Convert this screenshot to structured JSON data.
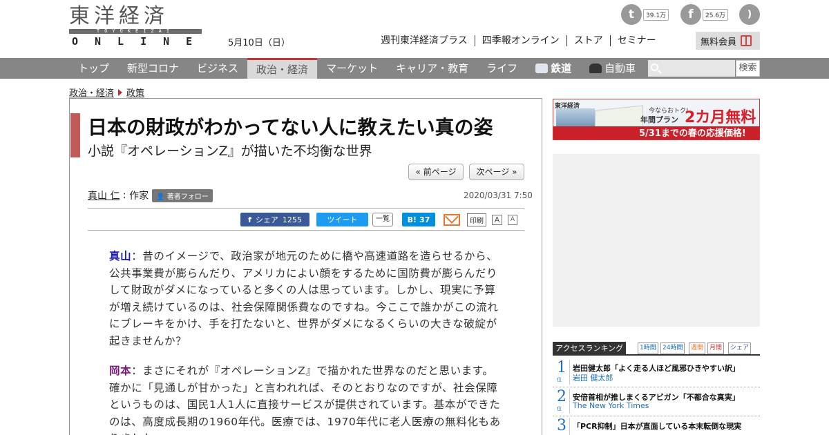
{
  "header": {
    "logo_kanji": "東洋経済",
    "logo_sub": "TOYOKEIZAI",
    "logo_online": "ONLINE",
    "date": "5月10日（日）",
    "twitter_count": "39.1万",
    "facebook_count": "25.6万",
    "top_links": [
      "週刊東洋経済プラス",
      "四季報オンライン",
      "ストア",
      "セミナー"
    ],
    "member_button": "無料会員"
  },
  "nav": {
    "items": [
      "トップ",
      "新型コロナ",
      "ビジネス",
      "政治・経済",
      "マーケット",
      "キャリア・教育",
      "ライフ",
      "鉄道",
      "自動車"
    ],
    "active_index": 3,
    "search_placeholder": "",
    "search_button": "検索"
  },
  "breadcrumb": [
    "政治・経済",
    "政策"
  ],
  "article": {
    "title": "日本の財政がわかってない人に教えたい真の姿",
    "subtitle": "小説『オペレーションZ』が描いた不均衡な世界",
    "prev_page": "« 前ページ",
    "next_page": "次ページ »",
    "author_name": "真山 仁",
    "author_role": "作家",
    "follow_label": "著者フォロー",
    "date": "2020/03/31 7:50",
    "share": {
      "facebook_label": "シェア",
      "facebook_count": "1255",
      "tweet_label": "ツイート",
      "list_label": "一覧",
      "hatena_label": "B!",
      "hatena_count": "37",
      "print_label": "印刷",
      "font_large": "A",
      "font_small": "A"
    },
    "paragraphs": [
      {
        "speaker": "真山",
        "speaker_color": "#1a1aa8",
        "text": "：昔のイメージで、政治家が地元のために橋や高速道路を造らせるから、公共事業費が膨らんだり、アメリカによい顔をするために国防費が膨らんだりして財政がダメになっていると多くの人は思っています。しかし、現実に予算が増え続けているのは、社会保障関係費なのですね。今ここで誰かがこの流れにブレーキをかけ、手を打たないと、世界がダメになるくらいの大きな破綻が起きませんか？"
      },
      {
        "speaker": "岡本",
        "speaker_color": "#7a1a7a",
        "text": "：まさにそれが『オペレーションZ』で描かれた世界なのだと思います。確かに「見通しが甘かった」と言われれば、そのとおりなのですが、社会保障というものは、国民1人1人に直接サービスが提供されています。基本ができたのは、高度成長期の1960年代。医療では、1970年代に老人医療の無料化もありました。"
      }
    ]
  },
  "banner": {
    "brand": "東洋経済",
    "line1": "今ならおトク!",
    "line2": "年間プラン",
    "big": "2カ月無料",
    "strip": "5/31までの春の応援価格!"
  },
  "ranking": {
    "title": "アクセスランキング",
    "tabs": [
      "1時間",
      "24時間",
      "週間",
      "月間",
      "シェア"
    ],
    "items": [
      {
        "rank": "1",
        "title": "岩田健太郎「よく走る人ほど風邪ひきやすい訳」",
        "source": "岩田 健太郎"
      },
      {
        "rank": "2",
        "title": "安倍首相が推しまくるアビガン「不都合な真実」",
        "source": "The New York Times"
      },
      {
        "rank": "3",
        "title": "「PCR抑制」日本が直面している本末転倒な現実",
        "source": ""
      }
    ],
    "rank_suffix": "位"
  },
  "colors": {
    "accent_red": "#b33333",
    "nav_gray": "#868686",
    "link_blue": "#1a6ec2"
  }
}
